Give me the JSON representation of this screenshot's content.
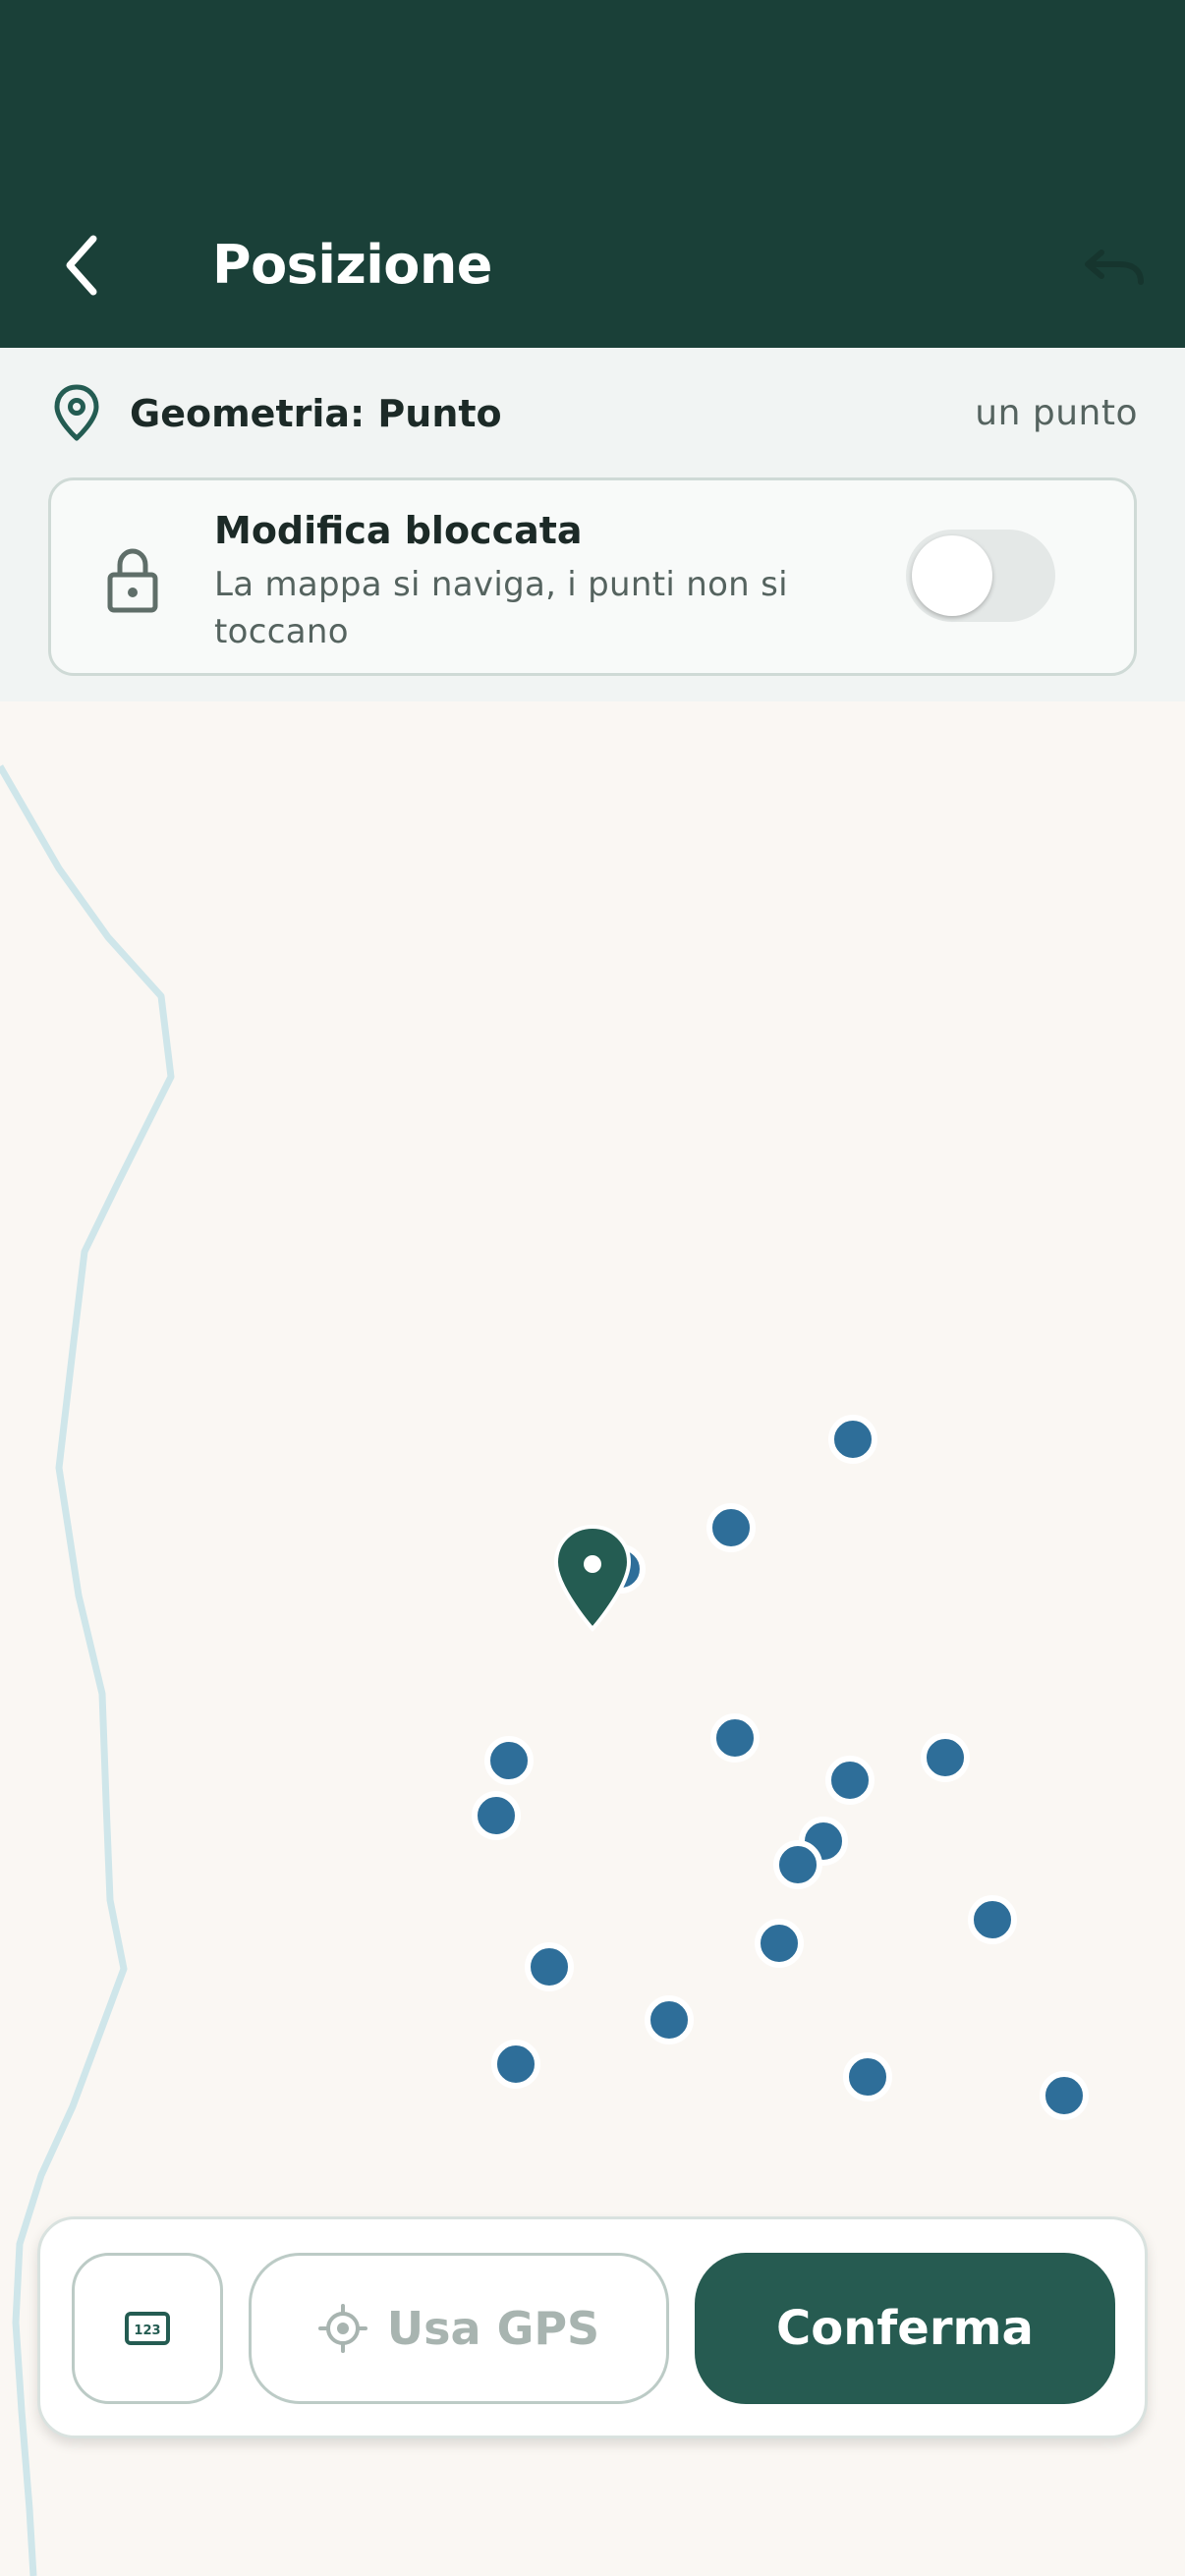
{
  "header": {
    "title": "Posizione",
    "background": "#1a4038",
    "back_icon": "chevron-left-icon",
    "undo_icon": "undo-icon"
  },
  "geometry": {
    "label": "Geometria: Punto",
    "count": "un punto",
    "icon": "map-pin-icon"
  },
  "lock_card": {
    "title": "Modifica bloccata",
    "subtitle": "La mappa si naviga, i punti non si toccano",
    "toggle_on": false,
    "icon": "lock-icon"
  },
  "map": {
    "background": "#faf7f3",
    "point_color": "#2e6e99",
    "marker_color": "#245c52",
    "river_color": "#cfe6ea"
  },
  "bottom_bar": {
    "numeric_button_icon": "numeric-keypad-icon",
    "numeric_button_text": "123",
    "gps_label": "Usa GPS",
    "gps_icon": "crosshair-icon",
    "confirm_label": "Conferma",
    "accent": "#265b51"
  }
}
